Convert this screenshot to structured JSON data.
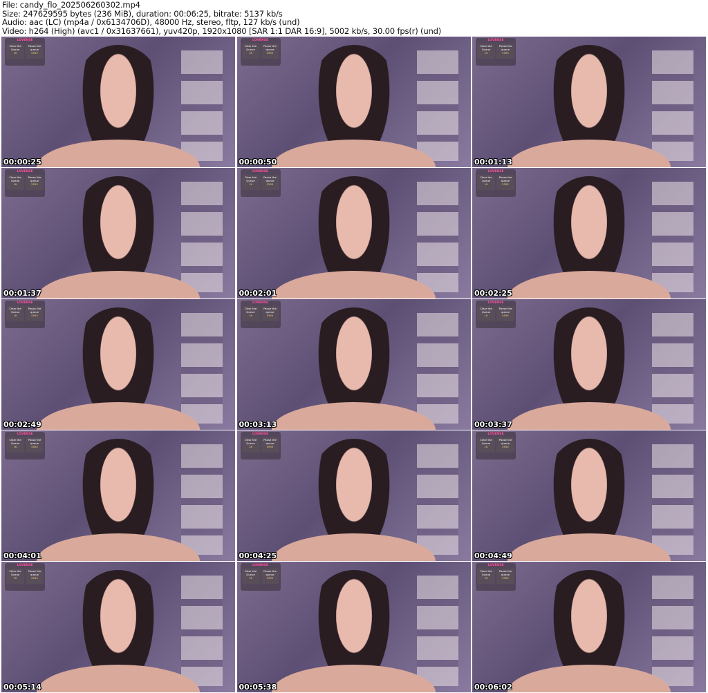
{
  "header": {
    "lines": [
      "File: candy_flo_202506260302.mp4",
      "Size: 247629595 bytes (236 MiB), duration: 00:06:25, bitrate: 5137 kb/s",
      "Audio: aac (LC) (mp4a / 0x6134706D), 48000 Hz, stereo, fltp, 127 kb/s (und)",
      "Video: h264 (High) (avc1 / 0x31637661), yuv420p, 1920x1080 [SAR 1:1 DAR 16:9], 5002 kb/s, 30.00 fps(r) (und)"
    ]
  },
  "widget": {
    "brand": "LOVENSE",
    "items": [
      {
        "label": "Clear the Queue",
        "value": "1K"
      },
      {
        "label": "Pause the queue",
        "value": "5555"
      }
    ]
  },
  "thumbnails": [
    {
      "timestamp": "00:00:25"
    },
    {
      "timestamp": "00:00:50"
    },
    {
      "timestamp": "00:01:13"
    },
    {
      "timestamp": "00:01:37"
    },
    {
      "timestamp": "00:02:01"
    },
    {
      "timestamp": "00:02:25"
    },
    {
      "timestamp": "00:02:49"
    },
    {
      "timestamp": "00:03:13"
    },
    {
      "timestamp": "00:03:37"
    },
    {
      "timestamp": "00:04:01"
    },
    {
      "timestamp": "00:04:25"
    },
    {
      "timestamp": "00:04:49"
    },
    {
      "timestamp": "00:05:14"
    },
    {
      "timestamp": "00:05:38"
    },
    {
      "timestamp": "00:06:02"
    }
  ]
}
